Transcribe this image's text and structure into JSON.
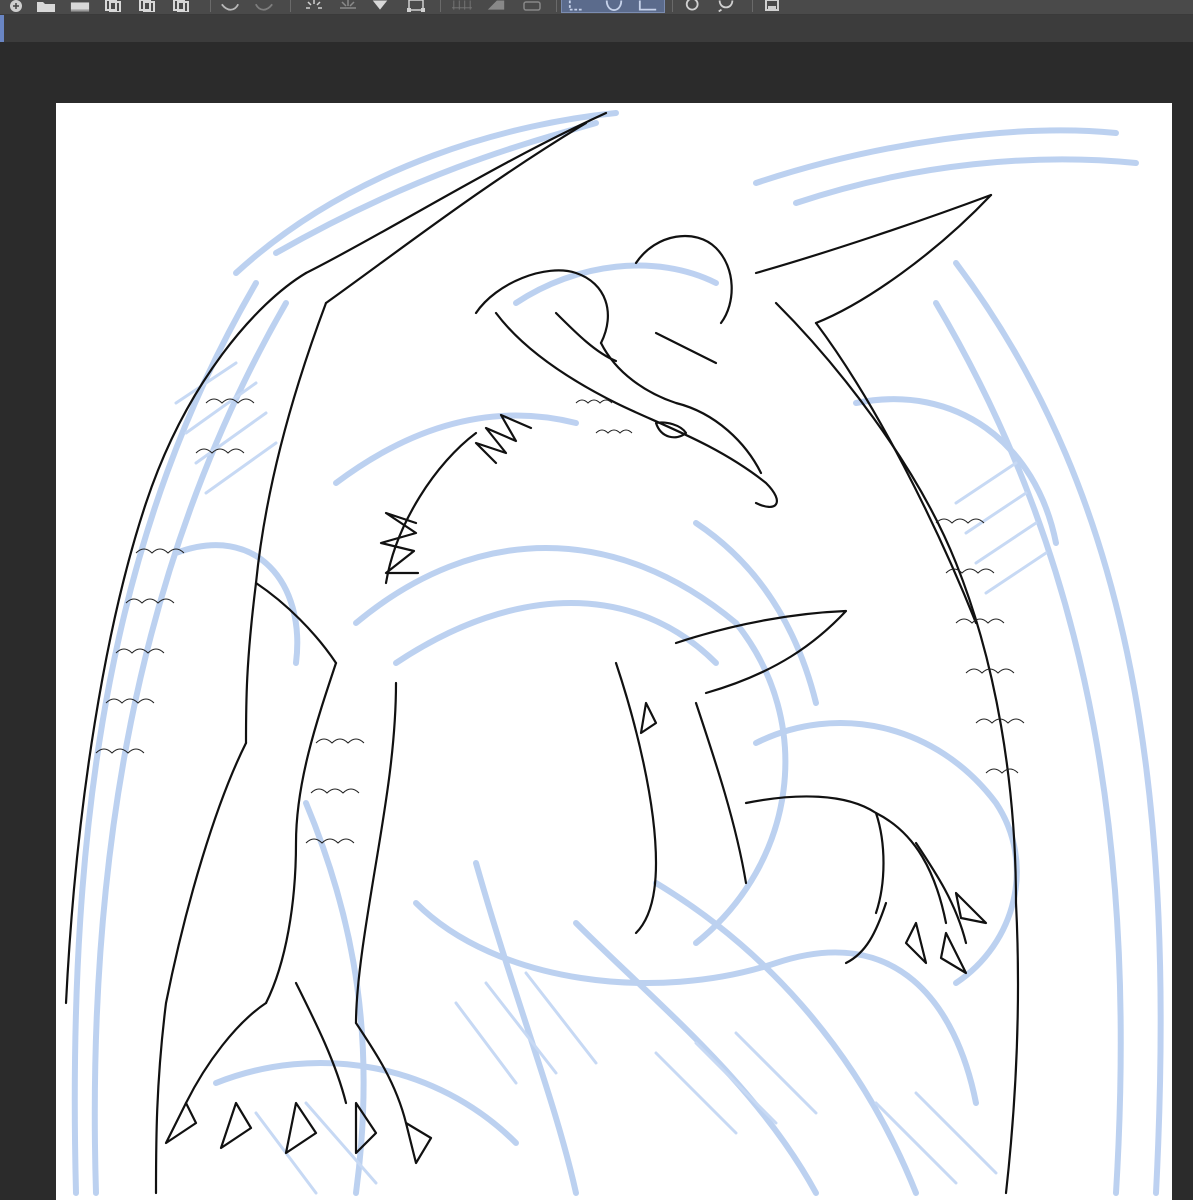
{
  "app": {
    "window_title": "",
    "accent_color": "#6a86c4",
    "toolbar_bg": "#4a4a4a",
    "workspace_bg": "#2b2b2b"
  },
  "toolbar": {
    "tools": [
      {
        "name": "new-file-icon"
      },
      {
        "name": "open-folder-icon"
      },
      {
        "name": "save-icon"
      },
      {
        "name": "undo-stack-icon"
      },
      {
        "name": "redo-stack-icon"
      },
      {
        "name": "layer-copy-icon"
      },
      {
        "name": "undo-icon"
      },
      {
        "name": "redo-icon"
      },
      {
        "name": "brightness-icon"
      },
      {
        "name": "sparkle-icon"
      },
      {
        "name": "fill-icon"
      },
      {
        "name": "transform-icon"
      },
      {
        "name": "grid-icon"
      },
      {
        "name": "eraser-icon"
      },
      {
        "name": "ruler-icon"
      },
      {
        "name": "select-rect-icon"
      },
      {
        "name": "select-ellipse-icon"
      },
      {
        "name": "select-lasso-icon"
      },
      {
        "name": "camera-icon"
      },
      {
        "name": "chat-icon"
      },
      {
        "name": "device-icon"
      }
    ]
  },
  "canvas": {
    "background": "#ffffff",
    "artwork": "dragon-sketch",
    "sketch_color": "#b9cff0",
    "line_color": "#111111"
  }
}
